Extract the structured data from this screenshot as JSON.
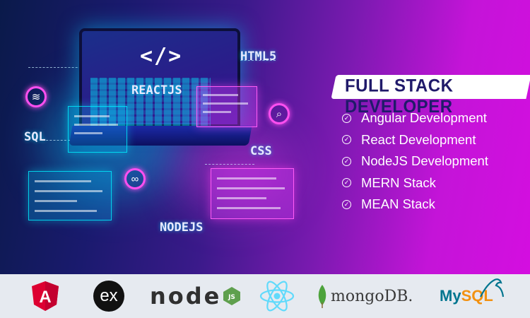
{
  "illustration": {
    "code_glyph": "</>",
    "labels": {
      "html5": "HTML5",
      "reactjs": "REACTJS",
      "sql": "SQL",
      "css": "CSS",
      "nodejs": "NODEJS"
    }
  },
  "headline": "FULL STACK DEVELOPER",
  "skills": [
    "Angular Development",
    "React Development",
    "NodeJS Development",
    "MERN Stack",
    "MEAN Stack"
  ],
  "logos": {
    "angular_letter": "A",
    "express": "ex",
    "node_text": "node",
    "node_badge": "JS",
    "mongo": "mongoDB.",
    "mysql_my": "My",
    "mysql_sql": "SQL"
  },
  "colors": {
    "headline_text": "#201a6a",
    "angular_red": "#dd0031",
    "react_blue": "#61dafb",
    "mongo_green": "#4da33c",
    "mysql_blue": "#00758f",
    "mysql_orange": "#f29111",
    "strip_bg": "#e6eaf0"
  },
  "icons": [
    "code-icon",
    "wifi-icon",
    "search-icon",
    "link-icon",
    "check-circle-icon",
    "angular-logo-icon",
    "express-logo-icon",
    "nodejs-logo-icon",
    "react-logo-icon",
    "mongodb-leaf-icon",
    "mysql-dolphin-icon"
  ]
}
